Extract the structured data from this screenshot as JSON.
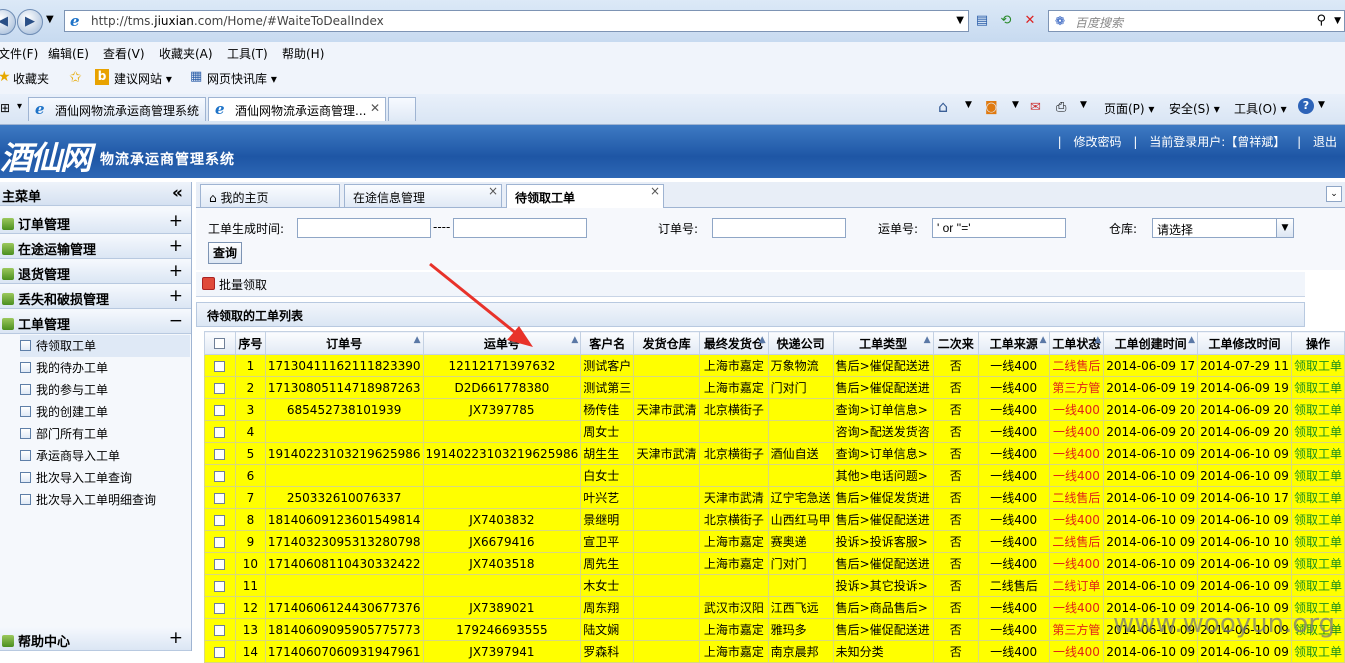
{
  "browser": {
    "url": "http://tms.jiuxian.com/Home/#WaiteToDealIndex",
    "url_host_prefix": "http://tms.",
    "url_host": "jiuxian",
    "url_rest": ".com/Home/#WaiteToDealIndex",
    "search_placeholder": "百度搜索",
    "menu": [
      "文件(F)",
      "编辑(E)",
      "查看(V)",
      "收藏夹(A)",
      "工具(T)",
      "帮助(H)"
    ],
    "favorites_label": "收藏夹",
    "favorites_links": [
      "建议网站 ▾",
      "网页快讯库 ▾"
    ],
    "tabs": [
      "酒仙网物流承运商管理系统",
      "酒仙网物流承运商管理..."
    ],
    "right_tools": [
      "页面(P) ▾",
      "安全(S) ▾",
      "工具(O) ▾"
    ]
  },
  "header": {
    "logo": "酒仙网",
    "system_title": "物流承运商管理系统",
    "change_password": "修改密码",
    "current_user_label": "当前登录用户:【曾祥斌】",
    "logout": "退出"
  },
  "sidebar": {
    "title": "主菜单",
    "collapse_glyph": "«",
    "groups": [
      {
        "label": "订单管理",
        "toggle": "+"
      },
      {
        "label": "在途运输管理",
        "toggle": "+"
      },
      {
        "label": "退货管理",
        "toggle": "+"
      },
      {
        "label": "丢失和破损管理",
        "toggle": "+"
      },
      {
        "label": "工单管理",
        "toggle": "−"
      }
    ],
    "items": [
      "待领取工单",
      "我的待办工单",
      "我的参与工单",
      "我的创建工单",
      "部门所有工单",
      "承运商导入工单",
      "批次导入工单查询",
      "批次导入工单明细查询"
    ],
    "help": {
      "label": "帮助中心",
      "toggle": "+"
    }
  },
  "content_tabs": [
    "我的主页",
    "在途信息管理",
    "待领取工单"
  ],
  "filter": {
    "created_time_label": "工单生成时间:",
    "range_sep": "----",
    "order_no_label": "订单号:",
    "waybill_label": "运单号:",
    "waybill_value": "' or ''='",
    "warehouse_label": "仓库:",
    "warehouse_value": "请选择",
    "query_button": "查询"
  },
  "toolbar": {
    "batch_claim": "批量领取"
  },
  "grid": {
    "title": "待领取的工单列表",
    "headers": [
      "序号",
      "订单号",
      "运单号",
      "客户名",
      "发货仓库",
      "最终发货仓",
      "快递公司",
      "工单类型",
      "二次来",
      "工单来源",
      "工单状态",
      "工单创建时间",
      "工单修改时间",
      "操作"
    ],
    "rows": [
      [
        "1",
        "17130411162111823390",
        "12112171397632",
        "测试客户",
        "",
        "上海市嘉定",
        "万象物流",
        "售后>催促配送进",
        "否",
        "一线400",
        "二线售后",
        "2014-06-09 17",
        "2014-07-29 11",
        "领取工单"
      ],
      [
        "2",
        "17130805114718987263",
        "D2D661778380",
        "测试第三",
        "",
        "上海市嘉定",
        "门对门",
        "售后>催促配送进",
        "否",
        "一线400",
        "第三方管",
        "2014-06-09 19",
        "2014-06-09 19",
        "领取工单"
      ],
      [
        "3",
        "685452738101939",
        "JX7397785",
        "杨传佳",
        "天津市武清",
        "北京横街子",
        "",
        "查询>订单信息>",
        "否",
        "一线400",
        "一线400",
        "2014-06-09 20",
        "2014-06-09 20",
        "领取工单"
      ],
      [
        "4",
        "",
        "",
        "周女士",
        "",
        "",
        "",
        "咨询>配送发货咨",
        "否",
        "一线400",
        "一线400",
        "2014-06-09 20",
        "2014-06-09 20",
        "领取工单"
      ],
      [
        "5",
        "19140223103219625986",
        "19140223103219625986",
        "胡生生",
        "天津市武清",
        "北京横街子",
        "酒仙自送",
        "查询>订单信息>",
        "否",
        "一线400",
        "一线400",
        "2014-06-10 09",
        "2014-06-10 09",
        "领取工单"
      ],
      [
        "6",
        "",
        "",
        "白女士",
        "",
        "",
        "",
        "其他>电话问题>",
        "否",
        "一线400",
        "一线400",
        "2014-06-10 09",
        "2014-06-10 09",
        "领取工单"
      ],
      [
        "7",
        "250332610076337",
        "",
        "叶兴艺",
        "",
        "天津市武清",
        "辽宁宅急送",
        "售后>催促发货进",
        "否",
        "一线400",
        "二线售后",
        "2014-06-10 09",
        "2014-06-10 17",
        "领取工单"
      ],
      [
        "8",
        "18140609123601549814",
        "JX7403832",
        "景继明",
        "",
        "北京横街子",
        "山西红马甲",
        "售后>催促配送进",
        "否",
        "一线400",
        "一线400",
        "2014-06-10 09",
        "2014-06-10 09",
        "领取工单"
      ],
      [
        "9",
        "17140323095313280798",
        "JX6679416",
        "宣卫平",
        "",
        "上海市嘉定",
        "赛奥递",
        "投诉>投诉客服>",
        "否",
        "一线400",
        "二线售后",
        "2014-06-10 09",
        "2014-06-10 10",
        "领取工单"
      ],
      [
        "10",
        "17140608110430332422",
        "JX7403518",
        "周先生",
        "",
        "上海市嘉定",
        "门对门",
        "售后>催促配送进",
        "否",
        "一线400",
        "一线400",
        "2014-06-10 09",
        "2014-06-10 09",
        "领取工单"
      ],
      [
        "11",
        "",
        "",
        "木女士",
        "",
        "",
        "",
        "投诉>其它投诉>",
        "否",
        "二线售后",
        "二线订单",
        "2014-06-10 09",
        "2014-06-10 09",
        "领取工单"
      ],
      [
        "12",
        "17140606124430677376",
        "JX7389021",
        "周东翔",
        "",
        "武汉市汉阳",
        "江西飞远",
        "售后>商品售后>",
        "否",
        "一线400",
        "一线400",
        "2014-06-10 09",
        "2014-06-10 09",
        "领取工单"
      ],
      [
        "13",
        "18140609095905775773",
        "179246693555",
        "陆文娴",
        "",
        "上海市嘉定",
        "雅玛多",
        "售后>催促配送进",
        "否",
        "一线400",
        "第三方管",
        "2014-06-10 09",
        "2014-06-10 09",
        "领取工单"
      ],
      [
        "14",
        "17140607060931947961",
        "JX7397941",
        "罗森科",
        "",
        "上海市嘉定",
        "南京晨邦",
        "未知分类",
        "否",
        "一线400",
        "一线400",
        "2014-06-10 09",
        "2014-06-10 09",
        "领取工单"
      ]
    ]
  },
  "watermark": "www.wooyun.org",
  "colors": {
    "row_bg": "#ffff00",
    "status_red": "#e0221a",
    "action_green": "#1c8f1c",
    "header_blue": "#1e56a5",
    "arrow": "#e8322a"
  }
}
